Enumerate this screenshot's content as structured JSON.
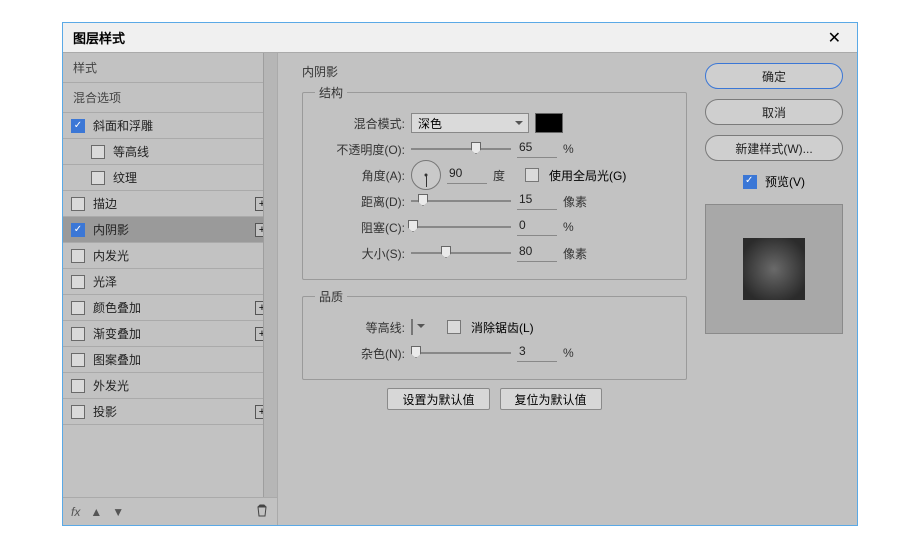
{
  "window": {
    "title": "图层样式"
  },
  "sidebar": {
    "header_styles": "样式",
    "header_blend": "混合选项",
    "items": [
      {
        "label": "斜面和浮雕",
        "checked": true,
        "plus": false,
        "sub": false,
        "selected": false
      },
      {
        "label": "等高线",
        "checked": false,
        "plus": false,
        "sub": true,
        "selected": false
      },
      {
        "label": "纹理",
        "checked": false,
        "plus": false,
        "sub": true,
        "selected": false
      },
      {
        "label": "描边",
        "checked": false,
        "plus": true,
        "sub": false,
        "selected": false
      },
      {
        "label": "内阴影",
        "checked": true,
        "plus": true,
        "sub": false,
        "selected": true
      },
      {
        "label": "内发光",
        "checked": false,
        "plus": false,
        "sub": false,
        "selected": false
      },
      {
        "label": "光泽",
        "checked": false,
        "plus": false,
        "sub": false,
        "selected": false
      },
      {
        "label": "颜色叠加",
        "checked": false,
        "plus": true,
        "sub": false,
        "selected": false
      },
      {
        "label": "渐变叠加",
        "checked": false,
        "plus": true,
        "sub": false,
        "selected": false
      },
      {
        "label": "图案叠加",
        "checked": false,
        "plus": false,
        "sub": false,
        "selected": false
      },
      {
        "label": "外发光",
        "checked": false,
        "plus": false,
        "sub": false,
        "selected": false
      },
      {
        "label": "投影",
        "checked": false,
        "plus": true,
        "sub": false,
        "selected": false
      }
    ],
    "footer_fx": "fx"
  },
  "effect": {
    "title": "内阴影",
    "structure_legend": "结构",
    "quality_legend": "品质",
    "blend_mode_label": "混合模式:",
    "blend_mode_value": "深色",
    "color": "#000000",
    "opacity_label": "不透明度(O):",
    "opacity_value": "65",
    "opacity_unit": "%",
    "angle_label": "角度(A):",
    "angle_value": "90",
    "angle_unit": "度",
    "global_light_label": "使用全局光(G)",
    "global_light_checked": false,
    "distance_label": "距离(D):",
    "distance_value": "15",
    "distance_unit": "像素",
    "choke_label": "阻塞(C):",
    "choke_value": "0",
    "choke_unit": "%",
    "size_label": "大小(S):",
    "size_value": "80",
    "size_unit": "像素",
    "contour_label": "等高线:",
    "antialias_label": "消除锯齿(L)",
    "antialias_checked": false,
    "noise_label": "杂色(N):",
    "noise_value": "3",
    "noise_unit": "%",
    "set_default": "设置为默认值",
    "reset_default": "复位为默认值"
  },
  "right": {
    "ok": "确定",
    "cancel": "取消",
    "new_style": "新建样式(W)...",
    "preview_label": "预览(V)",
    "preview_checked": true
  },
  "slider_pos": {
    "opacity": 65,
    "distance": 12,
    "choke": 2,
    "size": 35,
    "noise": 5
  }
}
